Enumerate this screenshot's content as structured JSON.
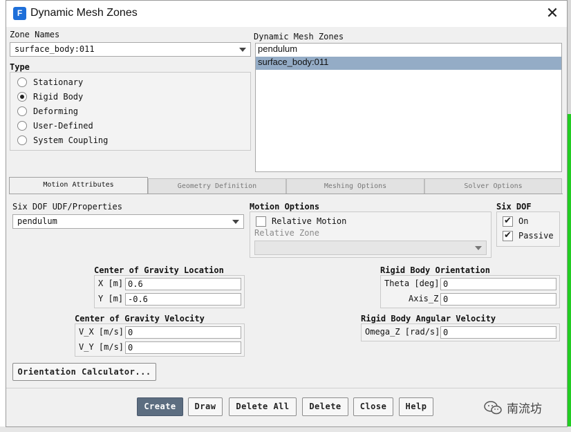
{
  "window": {
    "title": "Dynamic Mesh Zones",
    "app_icon_letter": "F"
  },
  "zone_names": {
    "label": "Zone Names",
    "selected": "surface_body:011"
  },
  "type": {
    "label": "Type",
    "options": [
      {
        "label": "Stationary",
        "selected": false
      },
      {
        "label": "Rigid Body",
        "selected": true
      },
      {
        "label": "Deforming",
        "selected": false
      },
      {
        "label": "User-Defined",
        "selected": false
      },
      {
        "label": "System Coupling",
        "selected": false
      }
    ]
  },
  "dynamic_mesh_zones": {
    "label": "Dynamic Mesh Zones",
    "items": [
      "pendulum",
      "surface_body:011"
    ],
    "selected_index": 1
  },
  "tabs": [
    "Motion Attributes",
    "Geometry Definition",
    "Meshing Options",
    "Solver Options"
  ],
  "active_tab": "Motion Attributes",
  "six_dof_udf": {
    "label": "Six DOF UDF/Properties",
    "selected": "pendulum"
  },
  "motion_options": {
    "label": "Motion Options",
    "relative_motion_label": "Relative Motion",
    "relative_motion_checked": false,
    "relative_zone_label": "Relative Zone",
    "relative_zone_value": ""
  },
  "six_dof": {
    "label": "Six DOF",
    "on_label": "On",
    "on_checked": true,
    "passive_label": "Passive",
    "passive_checked": true
  },
  "cg_location": {
    "label": "Center of Gravity Location",
    "x_label": "X [m]",
    "x_value": "0.6",
    "y_label": "Y [m]",
    "y_value": "-0.6"
  },
  "rb_orientation": {
    "label": "Rigid Body Orientation",
    "theta_label": "Theta [deg]",
    "theta_value": "0",
    "axis_label": "Axis_Z",
    "axis_value": "0"
  },
  "cg_velocity": {
    "label": "Center of Gravity Velocity",
    "vx_label": "V_X [m/s]",
    "vx_value": "0",
    "vy_label": "V_Y [m/s]",
    "vy_value": "0"
  },
  "rb_angular_velocity": {
    "label": "Rigid Body Angular Velocity",
    "omega_label": "Omega_Z [rad/s]",
    "omega_value": "0"
  },
  "orientation_calculator": "Orientation Calculator...",
  "buttons": {
    "create": "Create",
    "draw": "Draw",
    "delete_all": "Delete All",
    "delete": "Delete",
    "close": "Close",
    "help": "Help"
  },
  "watermark": "南流坊",
  "colors": {
    "selection": "#94acc6",
    "primary_button": "#5c6d80",
    "accent_green": "#22cc22"
  }
}
